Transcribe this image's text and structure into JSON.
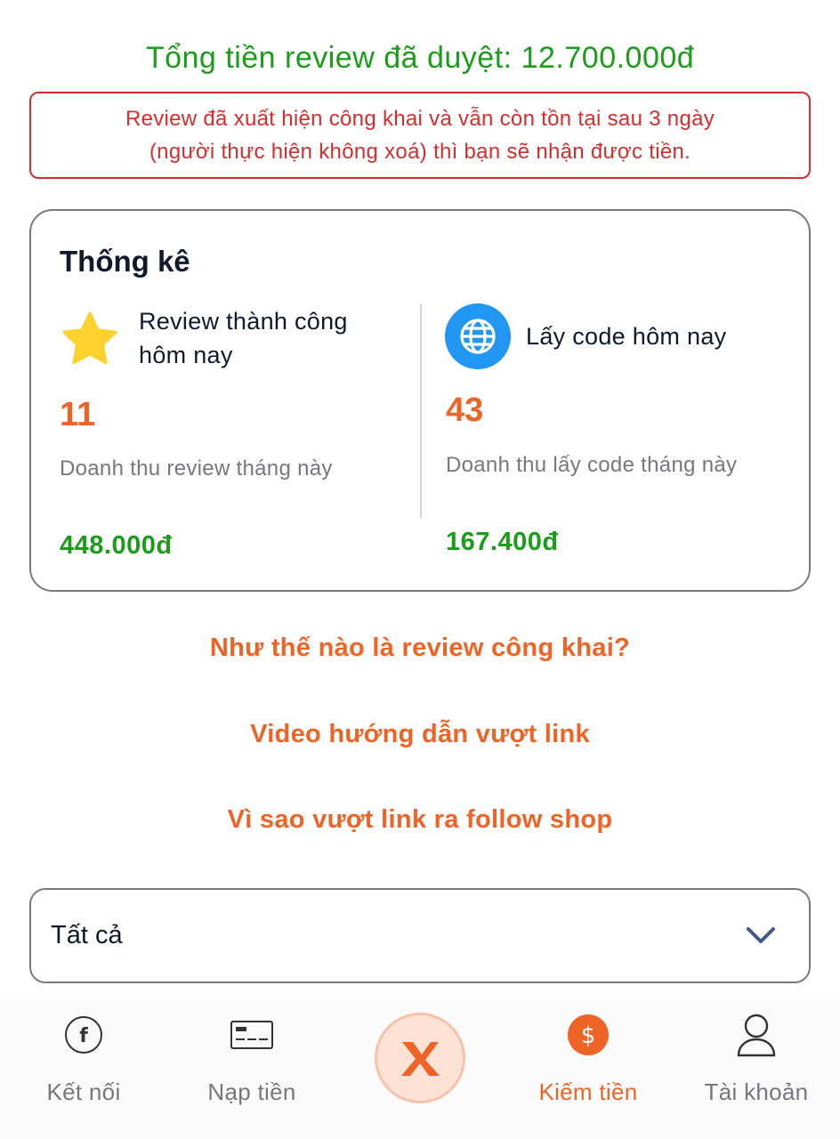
{
  "summary": {
    "total_label": "Tổng tiền review đã duyệt:",
    "total_amount": "12.700.000đ"
  },
  "notice": {
    "line1": "Review đã xuất hiện công khai và vẫn còn tồn tại sau 3 ngày",
    "line2": "(người thực hiện không xoá) thì bạn sẽ nhận được tiền."
  },
  "stats": {
    "title": "Thống kê",
    "left": {
      "label": "Review thành công hôm nay",
      "count": "11",
      "sub_label": "Doanh thu review tháng này",
      "amount": "448.000đ",
      "icon": "star-icon"
    },
    "right": {
      "label": "Lấy code hôm nay",
      "count": "43",
      "sub_label": "Doanh thu lấy code tháng này",
      "amount": "167.400đ",
      "icon": "globe-icon"
    }
  },
  "links": [
    {
      "label": "Như thế nào là review công khai?"
    },
    {
      "label": "Video hướng dẫn vượt link"
    },
    {
      "label": "Vì sao vượt link ra follow shop"
    }
  ],
  "filter": {
    "selected": "Tất cả",
    "icon": "chevron-down-icon"
  },
  "nav": {
    "items": [
      {
        "label": "Kết nối",
        "icon": "facebook-icon",
        "active": false
      },
      {
        "label": "Nạp tiền",
        "icon": "card-icon",
        "active": false
      },
      {
        "label": "Kiếm tiền",
        "icon": "dollar-icon",
        "active": true
      },
      {
        "label": "Tài khoản",
        "icon": "user-icon",
        "active": false
      }
    ],
    "center_icon": "x-logo-icon"
  },
  "colors": {
    "success": "#1a9e1a",
    "danger": "#d62d2d",
    "accent": "#ee6426",
    "globe": "#2196f3",
    "star": "#fdd22e"
  }
}
